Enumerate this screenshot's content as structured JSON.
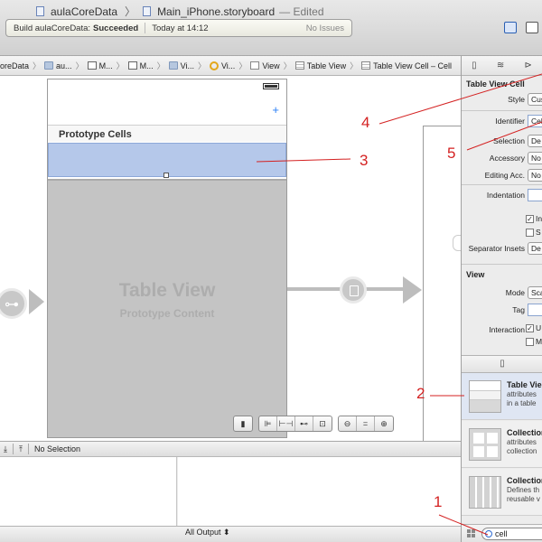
{
  "window": {
    "project": "aulaCoreData",
    "file": "Main_iPhone.storyboard",
    "status": "Edited"
  },
  "activity": {
    "prefix": "Build aulaCoreData:",
    "result": "Succeeded",
    "time": "Today at 14:12",
    "issues": "No Issues"
  },
  "jumpbar": [
    "oreData",
    "au...",
    "M...",
    "M...",
    "Vi...",
    "Vi...",
    "View",
    "Table View",
    "Table View Cell – Cell"
  ],
  "scene": {
    "plus": "+",
    "prototype_title": "Prototype Cells",
    "table_view_label": "Table View",
    "table_view_sub": "Prototype Content"
  },
  "debug": {
    "no_selection": "No Selection",
    "output": "All Output ⬍"
  },
  "inspector": {
    "cell_section": "Table View Cell",
    "style_label": "Style",
    "style_value": "Cus",
    "identifier_label": "Identifier",
    "identifier_value": "Cell",
    "selection_label": "Selection",
    "selection_value": "De",
    "accessory_label": "Accessory",
    "accessory_value": "No",
    "editing_label": "Editing Acc.",
    "editing_value": "No",
    "indentation_label": "Indentation",
    "check1_label": "In",
    "check2_label": "S",
    "separator_label": "Separator Insets",
    "separator_value": "De",
    "view_section": "View",
    "mode_label": "Mode",
    "mode_value": "Sca",
    "tag_label": "Tag",
    "interaction_label": "Interaction",
    "check3_label": "U",
    "check4_label": "M"
  },
  "library": [
    {
      "name": "Table Vie",
      "desc1": "attributes",
      "desc2": "in a table"
    },
    {
      "name": "Collection",
      "desc1": "attributes",
      "desc2": "collection"
    },
    {
      "name": "Collection",
      "desc1": "Defines th",
      "desc2": "reusable v"
    }
  ],
  "filter": {
    "value": "cell"
  },
  "annotations": [
    "1",
    "2",
    "3",
    "4",
    "5"
  ],
  "colors": {
    "annotation": "#d42121",
    "selection": "#b5c8ea"
  }
}
